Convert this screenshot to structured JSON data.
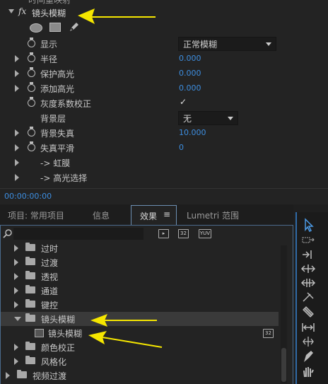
{
  "effect_controls": {
    "top_partial_label": "时间重映射",
    "effect_name": "镜头模糊",
    "fx_label": "fx",
    "mask_tools": [
      "ellipse-mask-icon",
      "rectangle-mask-icon",
      "pen-mask-icon"
    ],
    "properties": [
      {
        "label": "显示",
        "type": "dropdown",
        "value": "正常模糊",
        "twirl": false,
        "stopwatch": true
      },
      {
        "label": "半径",
        "type": "number",
        "value": "0.000",
        "twirl": true,
        "stopwatch": true
      },
      {
        "label": "保护高光",
        "type": "number",
        "value": "0.000",
        "twirl": true,
        "stopwatch": true
      },
      {
        "label": "添加高光",
        "type": "number",
        "value": "0.000",
        "twirl": true,
        "stopwatch": true
      },
      {
        "label": "灰度系数校正",
        "type": "checkbox",
        "value": "✓",
        "twirl": false,
        "stopwatch": true
      },
      {
        "label": "背景层",
        "type": "dropdown",
        "value": "无",
        "twirl": false,
        "stopwatch": false
      },
      {
        "label": "背景失真",
        "type": "number",
        "value": "10.000",
        "twirl": true,
        "stopwatch": true
      },
      {
        "label": "失真平滑",
        "type": "number",
        "value": "0",
        "twirl": true,
        "stopwatch": true
      },
      {
        "label": "-> 虹膜",
        "type": "group",
        "value": "",
        "twirl": true,
        "stopwatch": false
      },
      {
        "label": "-> 高光选择",
        "type": "group",
        "value": "",
        "twirl": true,
        "stopwatch": false
      }
    ],
    "timecode": "00:00:00:00"
  },
  "panel_tabs": {
    "project": "项目: 常用项目",
    "info": "信息",
    "effects": "效果",
    "menu_icon": "≡",
    "lumetri": "Lumetri 范围"
  },
  "effects_panel": {
    "search_placeholder": "",
    "filter_icons": [
      "accelerated-effects-icon",
      "32-bit-icon",
      "yuv-icon"
    ],
    "filter_labels": [
      "",
      "32",
      "YUV"
    ],
    "tree": [
      {
        "label": "过时",
        "kind": "folder",
        "open": false,
        "indent": 0
      },
      {
        "label": "过渡",
        "kind": "folder",
        "open": false,
        "indent": 0
      },
      {
        "label": "透视",
        "kind": "folder",
        "open": false,
        "indent": 0
      },
      {
        "label": "通道",
        "kind": "folder",
        "open": false,
        "indent": 0
      },
      {
        "label": "键控",
        "kind": "folder",
        "open": false,
        "indent": 0
      },
      {
        "label": "镜头模糊",
        "kind": "folder",
        "open": true,
        "indent": 0
      },
      {
        "label": "镜头模糊",
        "kind": "effect",
        "open": false,
        "indent": 1,
        "badge": "32"
      },
      {
        "label": "颜色校正",
        "kind": "folder",
        "open": false,
        "indent": 0
      },
      {
        "label": "风格化",
        "kind": "folder",
        "open": false,
        "indent": 0
      },
      {
        "label": "视频过渡",
        "kind": "folder",
        "open": false,
        "indent": -1
      }
    ]
  },
  "tools": [
    "selection-tool-icon",
    "track-select-forward-icon",
    "ripple-edit-icon",
    "rolling-edit-icon",
    "rate-stretch-icon",
    "razor-icon",
    "slip-icon",
    "slide-icon",
    "pen-tool-icon",
    "hand-tool-icon",
    "type-tool-icon"
  ],
  "colors": {
    "accent": "#3d8ee0",
    "annotation_arrow": "#f5e600",
    "panel_border": "#4a6a8c"
  }
}
